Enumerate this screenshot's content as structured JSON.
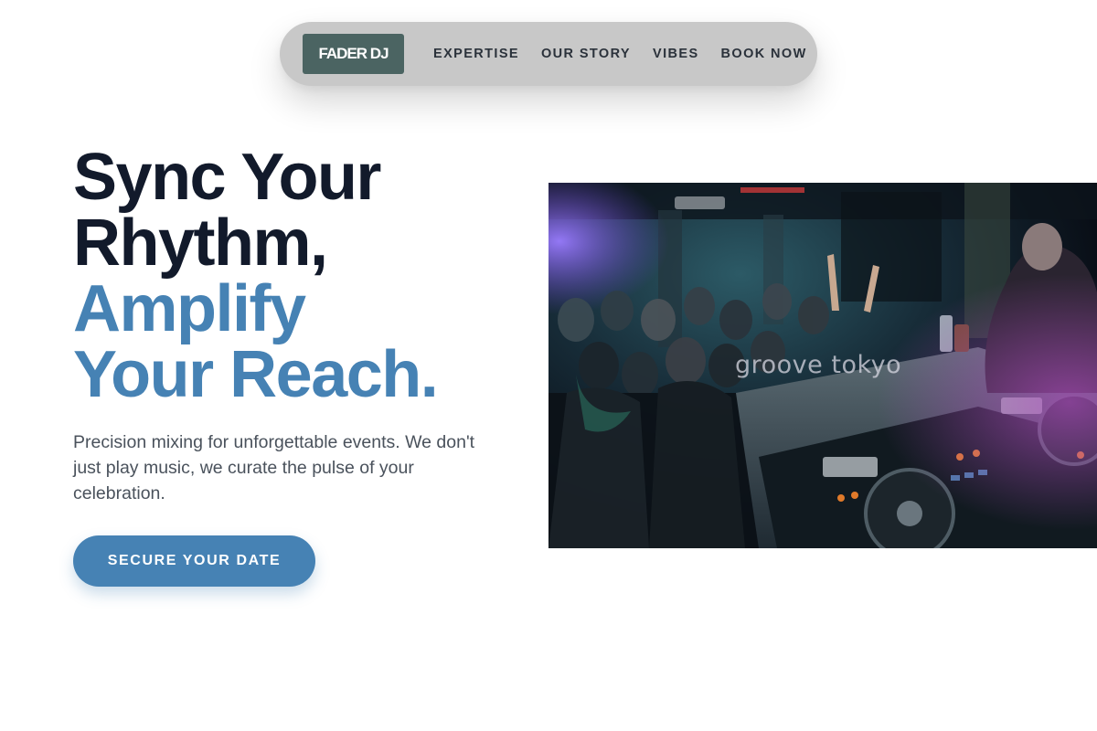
{
  "nav": {
    "logo": "FADER DJ",
    "links": [
      "EXPERTISE",
      "OUR STORY",
      "VIBES",
      "BOOK NOW"
    ]
  },
  "hero": {
    "title_line1": "Sync Your",
    "title_line2": "Rhythm,",
    "title_line3": "Amplify",
    "title_line4": "Your Reach.",
    "subtitle": "Precision mixing for unforgettable events. We don't just play music, we curate the pulse of your celebration.",
    "cta": "SECURE YOUR DATE",
    "image_watermark": "groove tokyo",
    "image_alt": "DJ performing at a crowded nightclub"
  },
  "colors": {
    "accent": "#4682b4",
    "heading_dark": "#121a2b",
    "logo_bg": "#4b6462",
    "nav_bg": "#c8c8c8"
  }
}
